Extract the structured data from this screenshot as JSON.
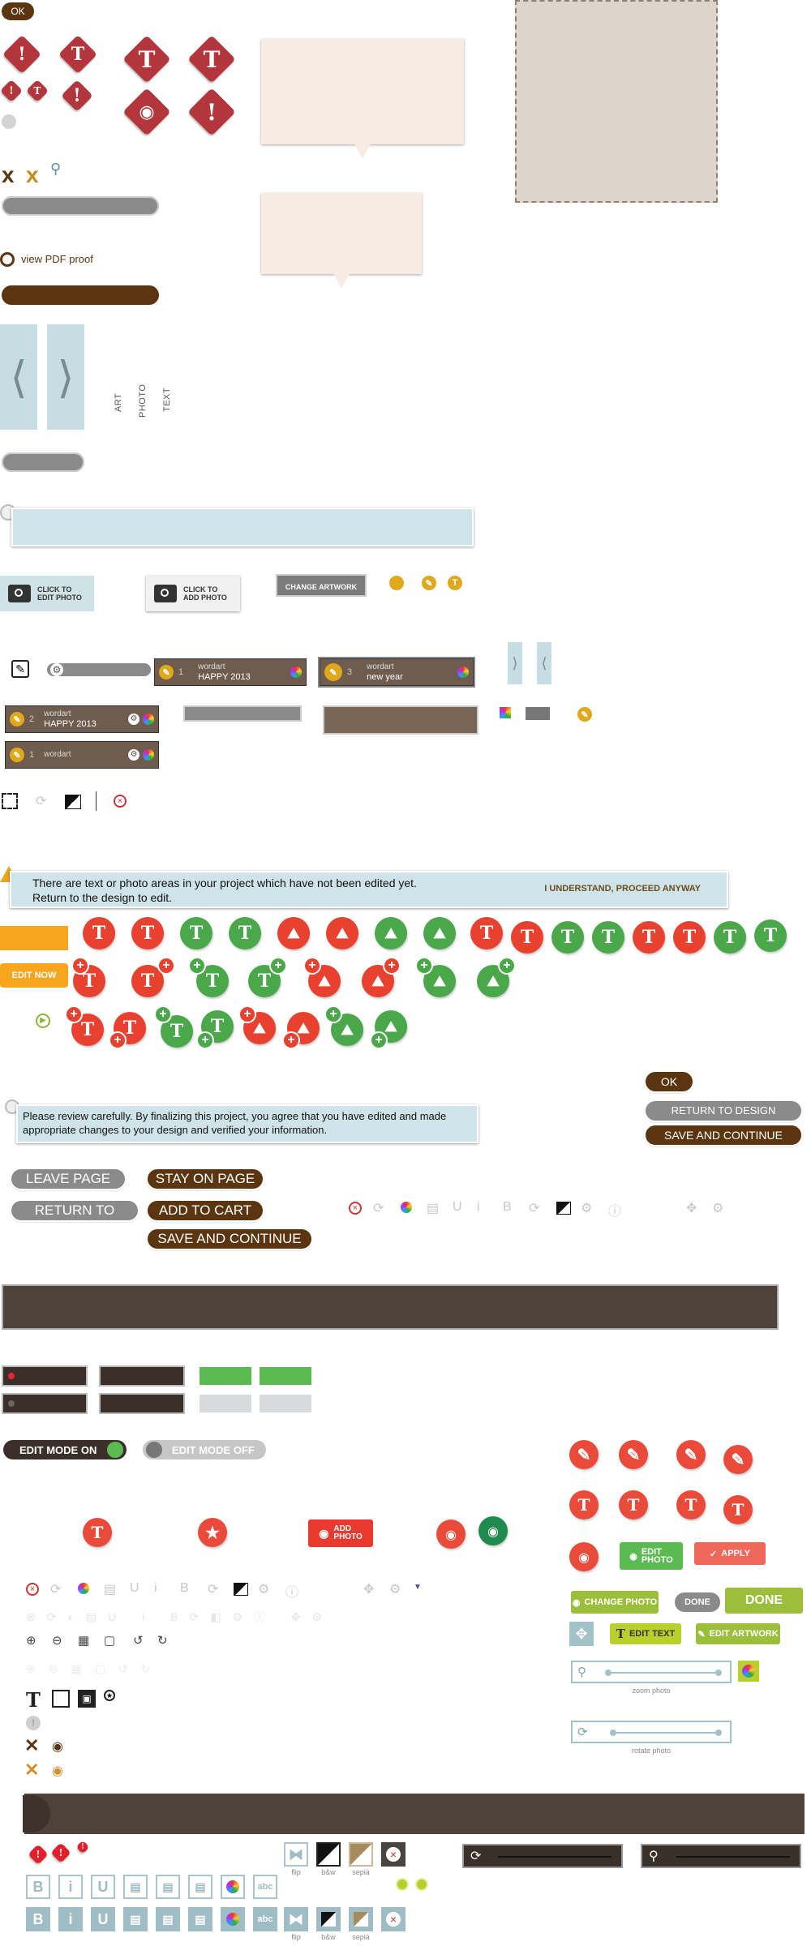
{
  "buttons": {
    "ok_top": "OK",
    "view_pdf": "view PDF proof",
    "click_edit_photo": "CLICK TO\nEDIT PHOTO",
    "click_add_photo": "CLICK TO\nADD PHOTO",
    "change_artwork": "CHANGE ARTWORK",
    "understand_proceed": "I UNDERSTAND, PROCEED ANYWAY",
    "edit_now": "EDIT NOW",
    "ok_right": "OK",
    "return_design_right": "RETURN TO DESIGN",
    "save_continue_right": "SAVE AND CONTINUE",
    "leave_page": "LEAVE PAGE",
    "stay_on_page": "STAY ON PAGE",
    "return_design": "RETURN TO DESIGN",
    "add_to_cart": "ADD TO CART",
    "save_continue": "SAVE AND CONTINUE",
    "edit_mode_on": "EDIT MODE ON",
    "edit_mode_off": "EDIT MODE OFF",
    "add_photo": "ADD\nPHOTO",
    "edit_photo": "EDIT\nPHOTO",
    "apply": "APPLY",
    "change_photo": "CHANGE PHOTO",
    "done_small": "DONE",
    "done_big": "DONE",
    "edit_text": "EDIT TEXT",
    "edit_artwork": "EDIT ARTWORK"
  },
  "tabs": {
    "art": "ART",
    "photo": "PHOTO",
    "text": "TEXT"
  },
  "wordart": [
    {
      "num": "1",
      "label": "wordart",
      "text": "HAPPY 2013"
    },
    {
      "num": "3",
      "label": "wordart",
      "text": "new year"
    },
    {
      "num": "2",
      "label": "wordart",
      "text": "HAPPY 2013"
    },
    {
      "num": "1",
      "label": "wordart",
      "text": ""
    }
  ],
  "overlap_text": "CHANGE ARTWORK",
  "messages": {
    "warning": "There are text or photo areas in your project which have not been edited yet. Return to the design to edit.",
    "review": "Please review carefully. By finalizing this project, you agree that you have edited and made appropriate changes to your design and verified your information."
  },
  "sliders": {
    "zoom": "zoom photo",
    "rotate": "rotate photo"
  },
  "tool_labels": {
    "flip": "flip",
    "bw": "b&w",
    "sepia": "sepia"
  },
  "colors": {
    "brown": "#5b3510",
    "red": "#b2363b",
    "pin_red": "#e8412f",
    "pin_green": "#4aa84b",
    "orange": "#f39c1a",
    "light_blue": "#cfe3e6",
    "dark_bar": "#4e423a",
    "lime": "#9bbf3a"
  }
}
